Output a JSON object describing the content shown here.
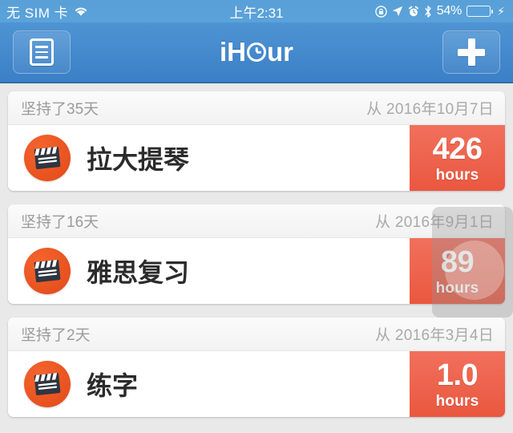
{
  "status_bar": {
    "carrier": "无 SIM 卡",
    "wifi_icon": "wifi-icon",
    "time": "上午2:31",
    "icons": [
      "rotation-lock-icon",
      "location-arrow-icon",
      "alarm-clock-icon",
      "bluetooth-icon"
    ],
    "battery_percent": "54%",
    "battery_level": 54,
    "charging_icon": "lightning-bolt-icon"
  },
  "nav_bar": {
    "left_button": {
      "name": "list-button",
      "icon": "document-list-icon"
    },
    "title_prefix": "iH",
    "title_clock_letter": "o",
    "title_suffix": "ur",
    "title_full": "iHour",
    "right_button": {
      "name": "add-button",
      "icon": "plus-icon"
    }
  },
  "colors": {
    "nav_blue_top": "#4e94d4",
    "nav_blue_bottom": "#3b80c6",
    "status_blue": "#59a0d8",
    "badge_orange_top": "#f1705c",
    "badge_orange_bottom": "#ea573f",
    "icon_orange": "#e8511f",
    "page_background": "#e9e9e9",
    "battery_green": "#4cd562"
  },
  "tasks": [
    {
      "days_text": "坚持了35天",
      "start_text": "从 2016年10月7日",
      "icon": "clapperboard-icon",
      "title": "拉大提琴",
      "hours": "426",
      "hours_label": "hours"
    },
    {
      "days_text": "坚持了16天",
      "start_text": "从 2016年9月1日",
      "icon": "clapperboard-icon",
      "title": "雅思复习",
      "hours": "89",
      "hours_label": "hours"
    },
    {
      "days_text": "坚持了2天",
      "start_text": "从 2016年3月4日",
      "icon": "clapperboard-icon",
      "title": "练字",
      "hours": "1.0",
      "hours_label": "hours"
    }
  ]
}
